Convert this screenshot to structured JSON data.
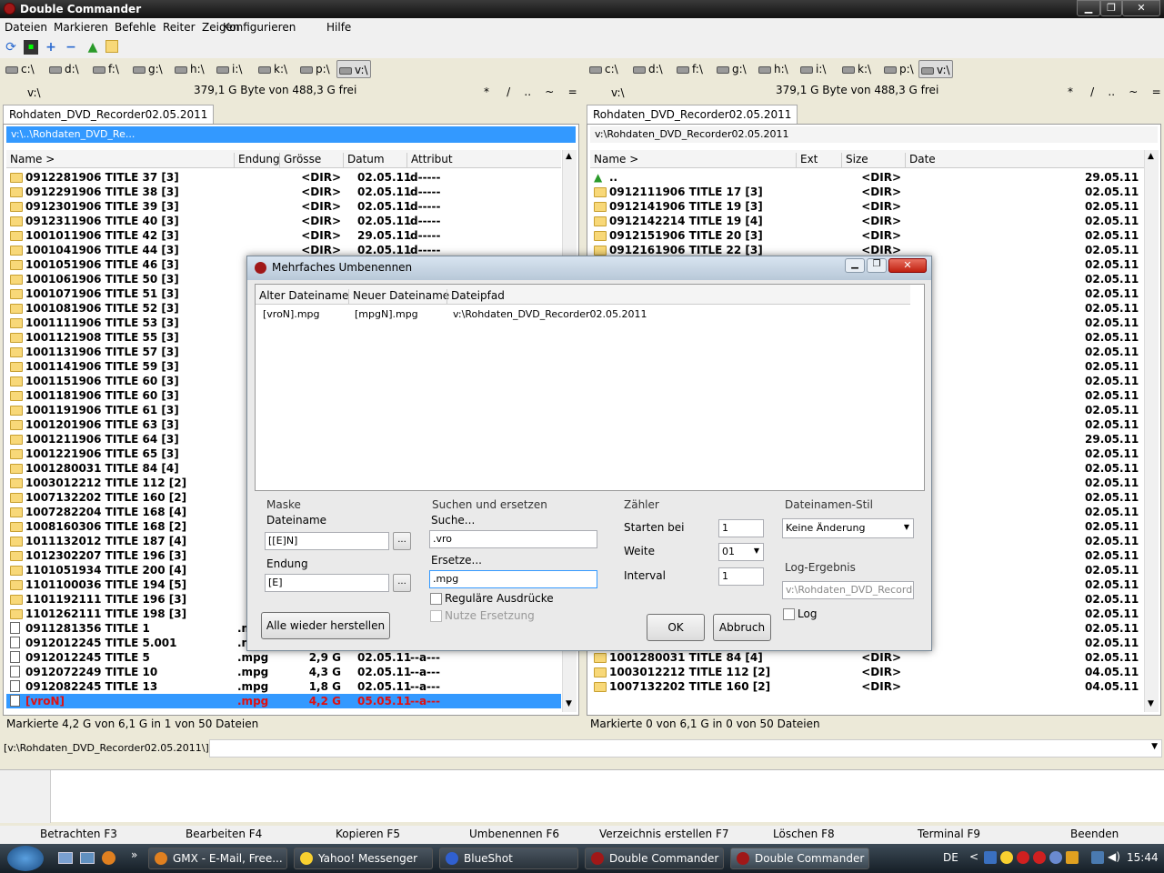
{
  "window": {
    "title": "Double Commander"
  },
  "menu": [
    "Dateien",
    "Markieren",
    "Befehle",
    "Reiter",
    "Zeigen",
    "Konfigurieren",
    "Hilfe"
  ],
  "drives": {
    "left": [
      "c:\\",
      "d:\\",
      "f:\\",
      "g:\\",
      "h:\\",
      "i:\\",
      "k:\\",
      "p:\\",
      "v:\\"
    ],
    "right": [
      "c:\\",
      "d:\\",
      "f:\\",
      "g:\\",
      "h:\\",
      "i:\\",
      "k:\\",
      "p:\\",
      "v:\\"
    ]
  },
  "left": {
    "drive": "v:\\",
    "free": "379,1 G Byte von 488,3 G frei",
    "tab": "Rohdaten_DVD_Recorder02.05.2011",
    "path": "v:\\..\\Rohdaten_DVD_Re...",
    "cols": [
      "Name >",
      "Endung",
      "Grösse",
      "Datum",
      "Attribut"
    ],
    "rows": [
      {
        "n": "0912281906 TITLE 37 [3]",
        "e": "",
        "s": "<DIR>",
        "d": "02.05.11",
        "a": "d-----",
        "t": "dir"
      },
      {
        "n": "0912291906 TITLE 38 [3]",
        "e": "",
        "s": "<DIR>",
        "d": "02.05.11",
        "a": "d-----",
        "t": "dir"
      },
      {
        "n": "0912301906 TITLE 39 [3]",
        "e": "",
        "s": "<DIR>",
        "d": "02.05.11",
        "a": "d-----",
        "t": "dir"
      },
      {
        "n": "0912311906 TITLE 40 [3]",
        "e": "",
        "s": "<DIR>",
        "d": "02.05.11",
        "a": "d-----",
        "t": "dir"
      },
      {
        "n": "1001011906 TITLE 42 [3]",
        "e": "",
        "s": "<DIR>",
        "d": "29.05.11",
        "a": "d-----",
        "t": "dir"
      },
      {
        "n": "1001041906 TITLE 44 [3]",
        "e": "",
        "s": "<DIR>",
        "d": "02.05.11",
        "a": "d-----",
        "t": "dir"
      },
      {
        "n": "1001051906 TITLE 46 [3]",
        "e": "",
        "s": "",
        "d": "",
        "a": "",
        "t": "dir"
      },
      {
        "n": "1001061906 TITLE 50 [3]",
        "e": "",
        "s": "",
        "d": "",
        "a": "",
        "t": "dir"
      },
      {
        "n": "1001071906 TITLE 51 [3]",
        "e": "",
        "s": "",
        "d": "",
        "a": "",
        "t": "dir"
      },
      {
        "n": "1001081906 TITLE 52 [3]",
        "e": "",
        "s": "",
        "d": "",
        "a": "",
        "t": "dir"
      },
      {
        "n": "1001111906 TITLE 53 [3]",
        "e": "",
        "s": "",
        "d": "",
        "a": "",
        "t": "dir"
      },
      {
        "n": "1001121908 TITLE 55 [3]",
        "e": "",
        "s": "",
        "d": "",
        "a": "",
        "t": "dir"
      },
      {
        "n": "1001131906 TITLE 57 [3]",
        "e": "",
        "s": "",
        "d": "",
        "a": "",
        "t": "dir"
      },
      {
        "n": "1001141906 TITLE 59 [3]",
        "e": "",
        "s": "",
        "d": "",
        "a": "",
        "t": "dir"
      },
      {
        "n": "1001151906 TITLE 60 [3]",
        "e": "",
        "s": "",
        "d": "",
        "a": "",
        "t": "dir"
      },
      {
        "n": "1001181906 TITLE 60 [3]",
        "e": "",
        "s": "",
        "d": "",
        "a": "",
        "t": "dir"
      },
      {
        "n": "1001191906 TITLE 61 [3]",
        "e": "",
        "s": "",
        "d": "",
        "a": "",
        "t": "dir"
      },
      {
        "n": "1001201906 TITLE 63 [3]",
        "e": "",
        "s": "",
        "d": "",
        "a": "",
        "t": "dir"
      },
      {
        "n": "1001211906 TITLE 64 [3]",
        "e": "",
        "s": "",
        "d": "",
        "a": "",
        "t": "dir"
      },
      {
        "n": "1001221906 TITLE 65 [3]",
        "e": "",
        "s": "",
        "d": "",
        "a": "",
        "t": "dir"
      },
      {
        "n": "1001280031 TITLE 84 [4]",
        "e": "",
        "s": "",
        "d": "",
        "a": "",
        "t": "dir"
      },
      {
        "n": "1003012212 TITLE 112 [2]",
        "e": "",
        "s": "",
        "d": "",
        "a": "",
        "t": "dir"
      },
      {
        "n": "1007132202 TITLE 160 [2]",
        "e": "",
        "s": "",
        "d": "",
        "a": "",
        "t": "dir"
      },
      {
        "n": "1007282204 TITLE 168 [4]",
        "e": "",
        "s": "",
        "d": "",
        "a": "",
        "t": "dir"
      },
      {
        "n": "1008160306 TITLE 168 [2]",
        "e": "",
        "s": "",
        "d": "",
        "a": "",
        "t": "dir"
      },
      {
        "n": "1011132012 TITLE 187 [4]",
        "e": "",
        "s": "",
        "d": "",
        "a": "",
        "t": "dir"
      },
      {
        "n": "1012302207 TITLE 196 [3]",
        "e": "",
        "s": "",
        "d": "",
        "a": "",
        "t": "dir"
      },
      {
        "n": "1101051934 TITLE 200 [4]",
        "e": "",
        "s": "",
        "d": "",
        "a": "",
        "t": "dir"
      },
      {
        "n": "1101100036 TITLE 194 [5]",
        "e": "",
        "s": "",
        "d": "",
        "a": "",
        "t": "dir"
      },
      {
        "n": "1101192111 TITLE 196 [3]",
        "e": "",
        "s": "",
        "d": "",
        "a": "",
        "t": "dir"
      },
      {
        "n": "1101262111 TITLE 198 [3]",
        "e": "",
        "s": "",
        "d": "",
        "a": "",
        "t": "dir"
      },
      {
        "n": "0911281356 TITLE 1",
        "e": ".m",
        "s": "",
        "d": "",
        "a": "",
        "t": "file"
      },
      {
        "n": "0912012245 TITLE 5.001",
        "e": ".n",
        "s": "",
        "d": "",
        "a": "",
        "t": "file"
      },
      {
        "n": "0912012245 TITLE 5",
        "e": ".mpg",
        "s": "2,9 G",
        "d": "02.05.11",
        "a": "--a---",
        "t": "file"
      },
      {
        "n": "0912072249 TITLE 10",
        "e": ".mpg",
        "s": "4,3 G",
        "d": "02.05.11",
        "a": "--a---",
        "t": "file"
      },
      {
        "n": "0912082245 TITLE 13",
        "e": ".mpg",
        "s": "1,8 G",
        "d": "02.05.11",
        "a": "--a---",
        "t": "file"
      },
      {
        "n": "[vroN]",
        "e": ".mpg",
        "s": "4,2 G",
        "d": "05.05.11",
        "a": "--a---",
        "t": "sel"
      }
    ],
    "status": "Markierte 4,2 G von 6,1 G in 1 von 50 Dateien"
  },
  "right": {
    "drive": "v:\\",
    "free": "379,1 G Byte von 488,3 G frei",
    "tab": "Rohdaten_DVD_Recorder02.05.2011",
    "path": "v:\\Rohdaten_DVD_Recorder02.05.2011",
    "cols": [
      "Name >",
      "Ext",
      "Size",
      "Date"
    ],
    "rows": [
      {
        "n": "..",
        "s": "<DIR>",
        "d": "29.05.11",
        "t": "up"
      },
      {
        "n": "0912111906 TITLE 17 [3]",
        "s": "<DIR>",
        "d": "02.05.11",
        "t": "dir"
      },
      {
        "n": "0912141906 TITLE 19 [3]",
        "s": "<DIR>",
        "d": "02.05.11",
        "t": "dir"
      },
      {
        "n": "0912142214 TITLE 19 [4]",
        "s": "<DIR>",
        "d": "02.05.11",
        "t": "dir"
      },
      {
        "n": "0912151906 TITLE 20 [3]",
        "s": "<DIR>",
        "d": "02.05.11",
        "t": "dir"
      },
      {
        "n": "0912161906 TITLE 22 [3]",
        "s": "<DIR>",
        "d": "02.05.11",
        "t": "dir"
      },
      {
        "n": "",
        "s": "",
        "d": "02.05.11",
        "t": "hid"
      },
      {
        "n": "",
        "s": "",
        "d": "02.05.11",
        "t": "hid"
      },
      {
        "n": "",
        "s": "",
        "d": "02.05.11",
        "t": "hid"
      },
      {
        "n": "",
        "s": "",
        "d": "02.05.11",
        "t": "hid"
      },
      {
        "n": "",
        "s": "",
        "d": "02.05.11",
        "t": "hid"
      },
      {
        "n": "",
        "s": "",
        "d": "02.05.11",
        "t": "hid"
      },
      {
        "n": "",
        "s": "",
        "d": "02.05.11",
        "t": "hid"
      },
      {
        "n": "",
        "s": "",
        "d": "02.05.11",
        "t": "hid"
      },
      {
        "n": "",
        "s": "",
        "d": "02.05.11",
        "t": "hid"
      },
      {
        "n": "",
        "s": "",
        "d": "02.05.11",
        "t": "hid"
      },
      {
        "n": "",
        "s": "",
        "d": "02.05.11",
        "t": "hid"
      },
      {
        "n": "",
        "s": "",
        "d": "02.05.11",
        "t": "hid"
      },
      {
        "n": "",
        "s": "",
        "d": "29.05.11",
        "t": "hid"
      },
      {
        "n": "",
        "s": "",
        "d": "02.05.11",
        "t": "hid"
      },
      {
        "n": "",
        "s": "",
        "d": "02.05.11",
        "t": "hid"
      },
      {
        "n": "",
        "s": "",
        "d": "02.05.11",
        "t": "hid"
      },
      {
        "n": "",
        "s": "",
        "d": "02.05.11",
        "t": "hid"
      },
      {
        "n": "",
        "s": "",
        "d": "02.05.11",
        "t": "hid"
      },
      {
        "n": "",
        "s": "",
        "d": "02.05.11",
        "t": "hid"
      },
      {
        "n": "",
        "s": "",
        "d": "02.05.11",
        "t": "hid"
      },
      {
        "n": "",
        "s": "",
        "d": "02.05.11",
        "t": "hid"
      },
      {
        "n": "",
        "s": "",
        "d": "02.05.11",
        "t": "hid"
      },
      {
        "n": "",
        "s": "",
        "d": "02.05.11",
        "t": "hid"
      },
      {
        "n": "",
        "s": "",
        "d": "02.05.11",
        "t": "hid"
      },
      {
        "n": "",
        "s": "",
        "d": "02.05.11",
        "t": "hid"
      },
      {
        "n": "",
        "s": "",
        "d": "02.05.11",
        "t": "hid"
      },
      {
        "n": "1001221906 TITLE 65 [3]",
        "s": "<DIR>",
        "d": "02.05.11",
        "t": "dir"
      },
      {
        "n": "1001280031 TITLE 84 [4]",
        "s": "<DIR>",
        "d": "02.05.11",
        "t": "dir"
      },
      {
        "n": "1003012212 TITLE 112 [2]",
        "s": "<DIR>",
        "d": "04.05.11",
        "t": "dir"
      },
      {
        "n": "1007132202 TITLE 160 [2]",
        "s": "<DIR>",
        "d": "04.05.11",
        "t": "dir"
      }
    ],
    "status": "Markierte 0 von 6,1 G in 0 von 50 Dateien"
  },
  "cmdline": {
    "prompt": "[v:\\Rohdaten_DVD_Recorder02.05.2011\\]$:"
  },
  "dialog": {
    "title": "Mehrfaches Umbenennen",
    "cols": [
      "Alter Dateiname",
      "Neuer Dateiname",
      "Dateipfad"
    ],
    "rows": [
      {
        "old": "[vroN].mpg",
        "new": "[mpgN].mpg",
        "path": "v:\\Rohdaten_DVD_Recorder02.05.2011"
      }
    ],
    "mask": {
      "legend": "Maske",
      "fname_label": "Dateiname",
      "fname": "[[E]N]",
      "ext_label": "Endung",
      "ext": "[E]",
      "browse": "..."
    },
    "search": {
      "legend": "Suchen und ersetzen",
      "find_label": "Suche...",
      "find": ".vro",
      "replace_label": "Ersetze...",
      "replace": ".mpg",
      "regex": "Reguläre Ausdrücke",
      "subst": "Nutze Ersetzung"
    },
    "counter": {
      "legend": "Zähler",
      "start_label": "Starten bei",
      "start": "1",
      "width_label": "Weite",
      "width": "01",
      "interval_label": "Interval",
      "interval": "1"
    },
    "style": {
      "legend": "Dateinamen-Stil",
      "value": "Keine Änderung"
    },
    "log": {
      "legend": "Log-Ergebnis",
      "path": "v:\\Rohdaten_DVD_Recorder",
      "checkbox": "Log"
    },
    "reset": "Alle wieder herstellen",
    "ok": "OK",
    "cancel": "Abbruch"
  },
  "fkeys": [
    "Betrachten F3",
    "Bearbeiten F4",
    "Kopieren F5",
    "Umbenennen F6",
    "Verzeichnis erstellen F7",
    "Löschen F8",
    "Terminal F9",
    "Beenden"
  ],
  "taskbar": {
    "tasks": [
      "GMX - E-Mail, Free...",
      "Yahoo! Messenger",
      "BlueShot",
      "Double Commander",
      "Double Commander"
    ],
    "lang": "DE",
    "time": "15:44"
  },
  "colors": {
    "selection": "#3399ff",
    "marked": "#e01010",
    "titlebar": "#222222"
  }
}
